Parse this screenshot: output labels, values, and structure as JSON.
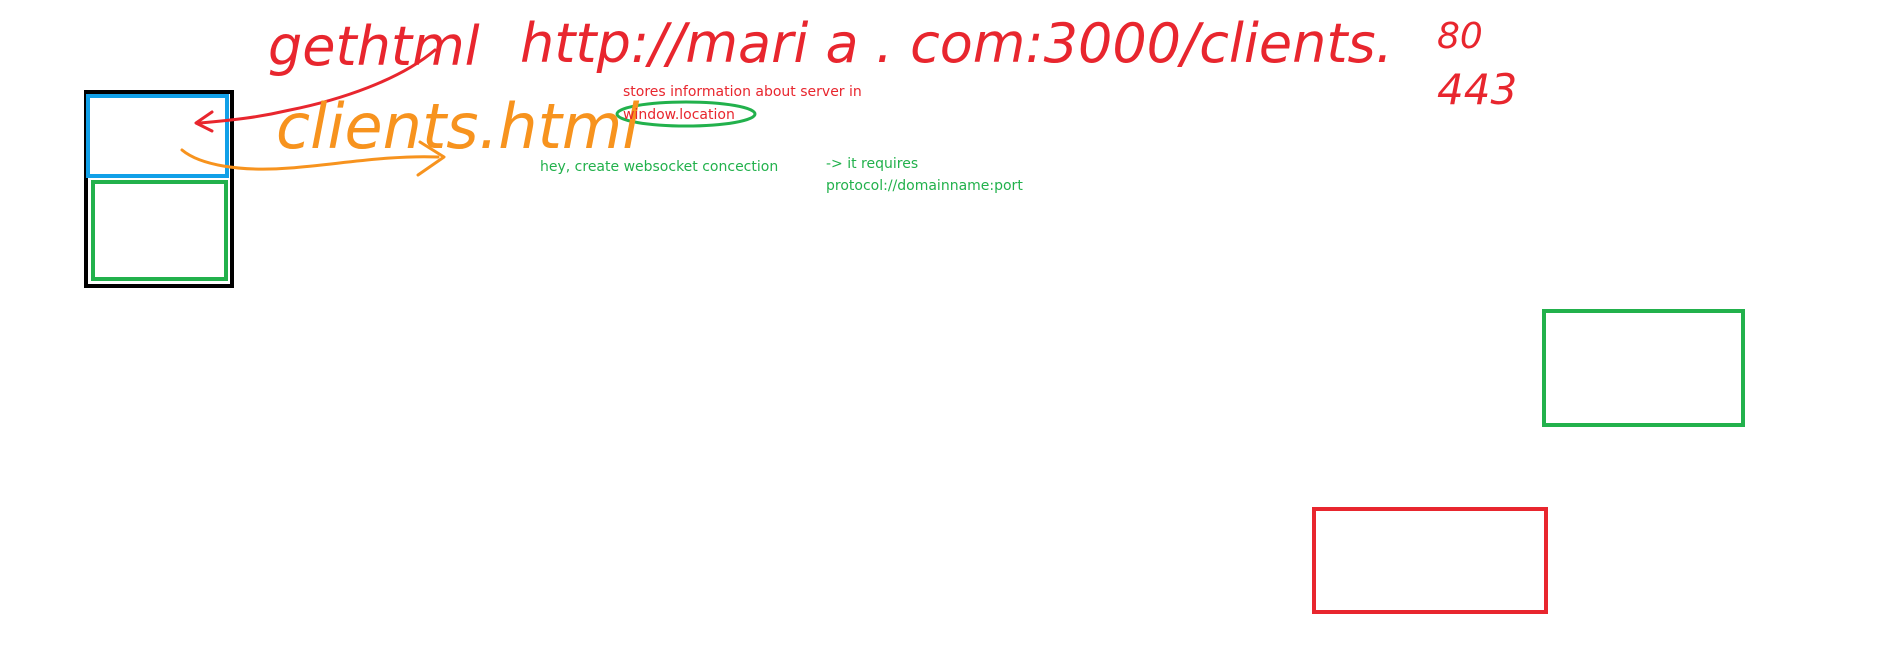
{
  "colors": {
    "red": "#e8262e",
    "orange": "#f7931e",
    "green": "#22b14c",
    "blue": "#11a0e8",
    "black": "#000000",
    "background": "#ffffff"
  },
  "handwriting": {
    "get_html": "gethtml",
    "url": "http://mari a . com:3000/clients.",
    "port_http": "80",
    "port_https": "443",
    "clients_file": "clients.html"
  },
  "notes": {
    "stores_line1": "stores information about server in",
    "window_location": "window.location",
    "websocket": "hey, create websocket concection",
    "requires_line1": "-> it requires",
    "requires_line2": "protocol://domainname:port"
  }
}
